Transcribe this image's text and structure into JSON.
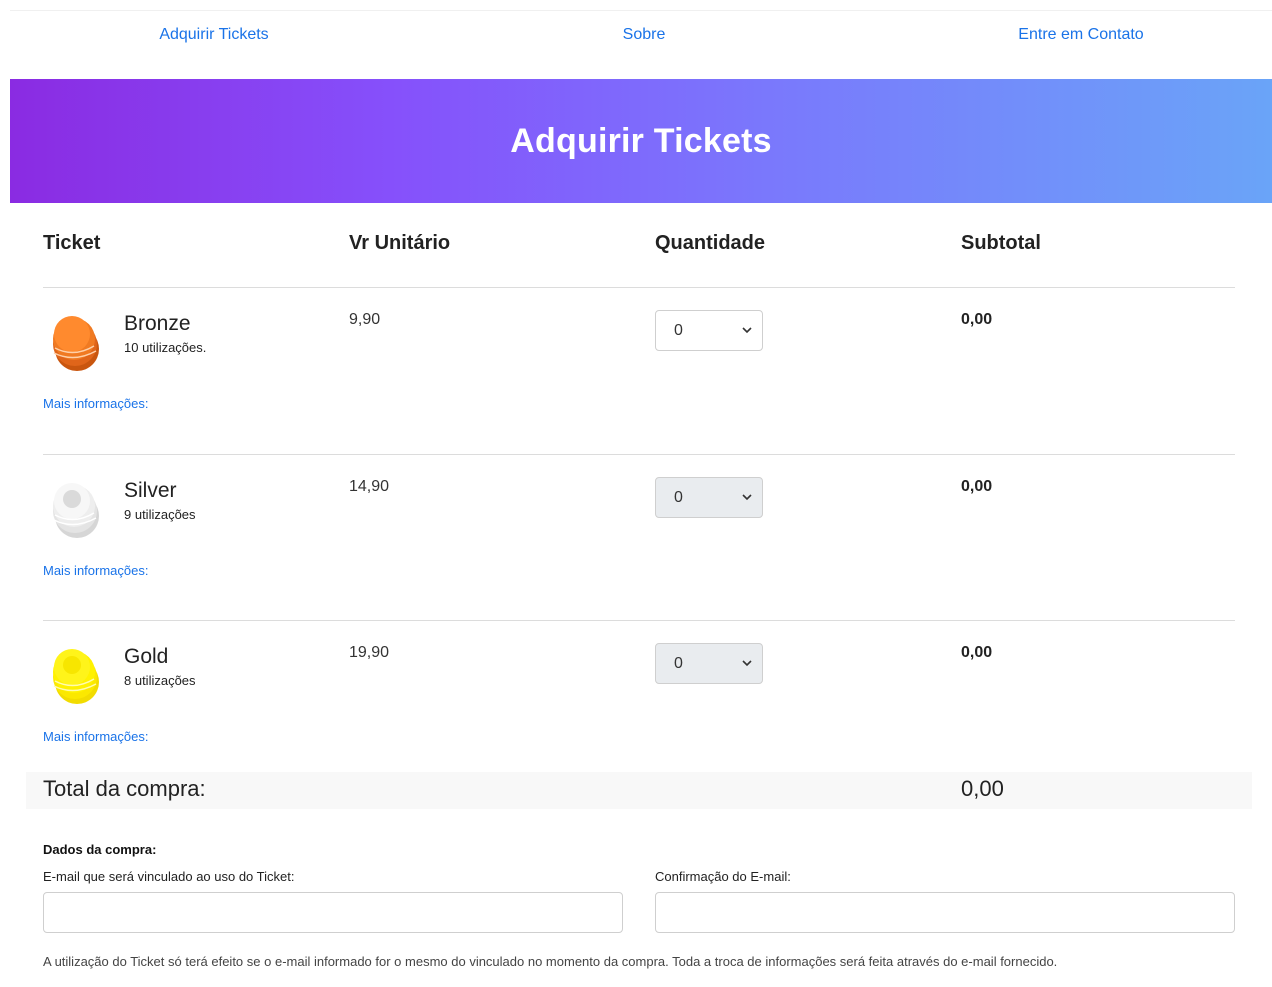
{
  "nav": {
    "items": [
      "Adquirir Tickets",
      "Sobre",
      "Entre em Contato"
    ]
  },
  "hero": {
    "title": "Adquirir Tickets"
  },
  "table": {
    "headers": [
      "Ticket",
      "Vr Unitário",
      "Quantidade",
      "Subtotal"
    ],
    "rows": [
      {
        "name": "Bronze",
        "uses": "10 utilizações.",
        "more": "Mais informações:",
        "price": "9,90",
        "quantity": "0",
        "subtotal": "0,00",
        "color": "#f0701a"
      },
      {
        "name": "Silver",
        "uses": "9 utilizações",
        "more": "Mais informações:",
        "price": "14,90",
        "quantity": "0",
        "subtotal": "0,00",
        "color": "#e8e8e8"
      },
      {
        "name": "Gold",
        "uses": "8 utilizações",
        "more": "Mais informações:",
        "price": "19,90",
        "quantity": "0",
        "subtotal": "0,00",
        "color": "#ffee00"
      }
    ]
  },
  "total": {
    "label": "Total da compra:",
    "value": "0,00"
  },
  "form": {
    "section_title": "Dados da compra:",
    "email_label": "E-mail que será vinculado ao uso do Ticket:",
    "email_value": "",
    "confirm_label": "Confirmação do E-mail:",
    "confirm_value": "",
    "note": "A utilização do Ticket só terá efeito se o e-mail informado for o mesmo do vinculado no momento da compra. Toda a troca de informações será feita através do e-mail fornecido."
  },
  "colors": {
    "link": "#1a73e8",
    "hero_start": "#8a2be2",
    "hero_end": "#6aa4f8"
  }
}
